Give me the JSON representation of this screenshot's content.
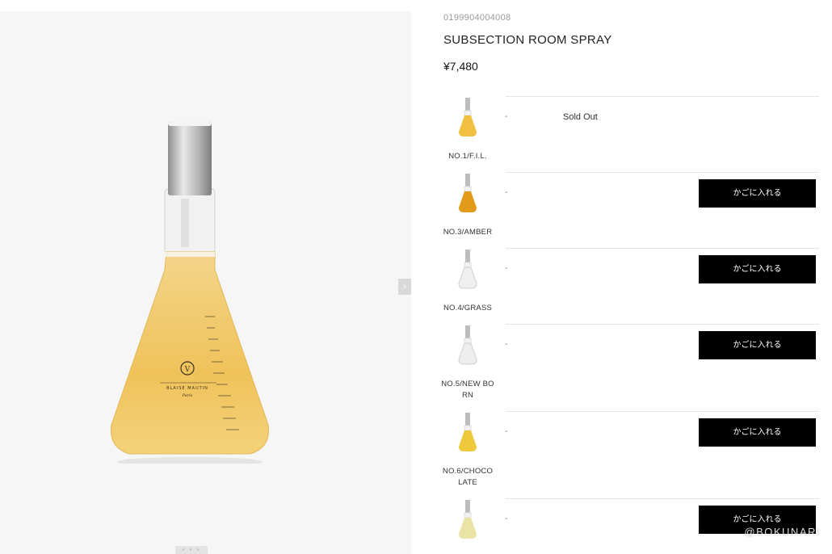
{
  "product": {
    "sku": "0199904004008",
    "title": "SUBSECTION ROOM SPRAY",
    "price": "¥7,480"
  },
  "gallery": {
    "next_arrow": "›",
    "dots": "• • •",
    "bottle_label": {
      "brand": "BLAISE MAUTIN",
      "city": "Paris",
      "monogram": "V"
    }
  },
  "variants": [
    {
      "name_lines": [
        "NO.1/F.I.L."
      ],
      "dash": "-",
      "status": "Sold Out",
      "cart_label": null,
      "liquid_color": "#f2c040"
    },
    {
      "name_lines": [
        "NO.3/AMBER"
      ],
      "dash": "-",
      "status": null,
      "cart_label": "かごに入れる",
      "liquid_color": "#e29a1a"
    },
    {
      "name_lines": [
        "NO.4/GRASS"
      ],
      "dash": "-",
      "status": null,
      "cart_label": "かごに入れる",
      "liquid_color": "#efefef"
    },
    {
      "name_lines": [
        "NO.5/NEW BO",
        "RN"
      ],
      "dash": "-",
      "status": null,
      "cart_label": "かごに入れる",
      "liquid_color": "#eeeeee"
    },
    {
      "name_lines": [
        "NO.6/CHOCO",
        "LATE"
      ],
      "dash": "-",
      "status": null,
      "cart_label": "かごに入れる",
      "liquid_color": "#efc93c"
    },
    {
      "name_lines": [],
      "dash": "-",
      "status": null,
      "cart_label": "かごに入れる",
      "liquid_color": "#e9e4a6"
    }
  ],
  "watermark": "@BOKUNARI"
}
